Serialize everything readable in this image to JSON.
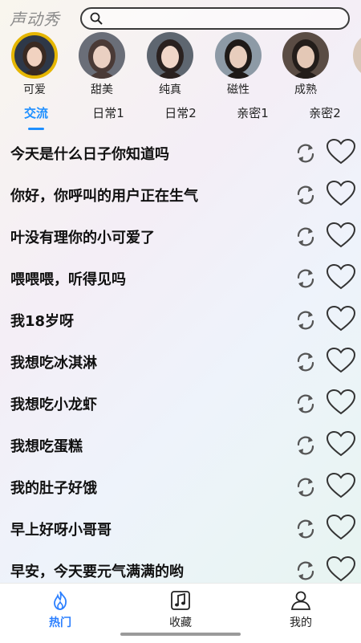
{
  "app": {
    "title": "声动秀"
  },
  "search": {
    "placeholder": ""
  },
  "voices": [
    {
      "label": "可爱",
      "selected": true,
      "skin": "#f1d2c0",
      "hair": "#3a2a22",
      "bg": "#2e3848"
    },
    {
      "label": "甜美",
      "selected": false,
      "skin": "#ead0c2",
      "hair": "#4a3a36",
      "bg": "#6a6e78"
    },
    {
      "label": "纯真",
      "selected": false,
      "skin": "#f0d6c8",
      "hair": "#2a211f",
      "bg": "#5e6670"
    },
    {
      "label": "磁性",
      "selected": false,
      "skin": "#e8cdbd",
      "hair": "#1f1a18",
      "bg": "#8d9aa6"
    },
    {
      "label": "成熟",
      "selected": false,
      "skin": "#e4c8b6",
      "hair": "#231d1a",
      "bg": "#5a4c44"
    }
  ],
  "tabs": [
    {
      "label": "交流",
      "active": true
    },
    {
      "label": "日常1",
      "active": false
    },
    {
      "label": "日常2",
      "active": false
    },
    {
      "label": "亲密1",
      "active": false
    },
    {
      "label": "亲密2",
      "active": false
    }
  ],
  "phrases": [
    "今天是什么日子你知道吗",
    "你好，你呼叫的用户正在生气",
    "叶没有理你的小可爱了",
    "喂喂喂，听得见吗",
    "我18岁呀",
    "我想吃冰淇淋",
    "我想吃小龙虾",
    "我想吃蛋糕",
    "我的肚子好饿",
    "早上好呀小哥哥",
    "早安，今天要元气满满的哟"
  ],
  "bottom_nav": [
    {
      "label": "热门",
      "icon": "flame-icon",
      "active": true
    },
    {
      "label": "收藏",
      "icon": "music-note-icon",
      "active": false
    },
    {
      "label": "我的",
      "icon": "user-icon",
      "active": false
    }
  ],
  "colors": {
    "accent": "#1e8fff",
    "selected_ring": "#e5b600",
    "nav_active": "#2b7fff"
  }
}
